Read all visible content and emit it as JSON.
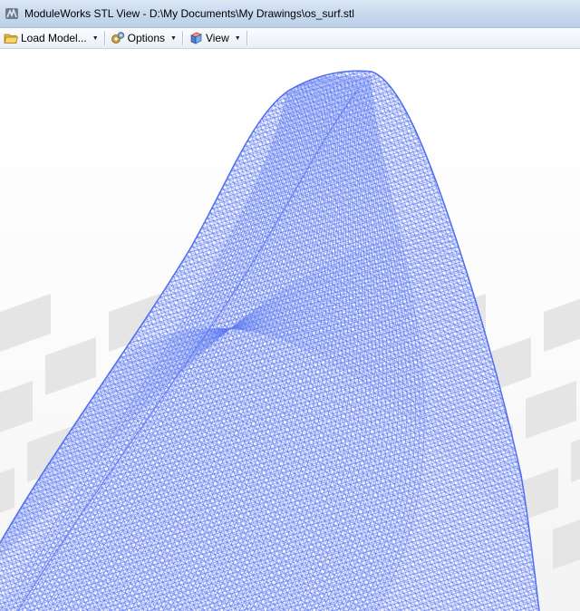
{
  "window": {
    "title": "ModuleWorks STL View - D:\\My Documents\\My Drawings\\os_surf.stl",
    "icon": "moduleworks-app-icon"
  },
  "toolbar": {
    "items": [
      {
        "label": "Load Model...",
        "icon": "folder-open-icon",
        "has_dropdown": true
      },
      {
        "label": "Options",
        "icon": "options-gears-icon",
        "has_dropdown": true
      },
      {
        "label": "View",
        "icon": "view-cube-icon",
        "has_dropdown": true
      }
    ]
  },
  "viewport": {
    "content": "stl-wireframe-mesh",
    "mesh_color": "#5b78f0",
    "background": "#ffffff",
    "floor_checker_color": "#e2e2e2"
  }
}
